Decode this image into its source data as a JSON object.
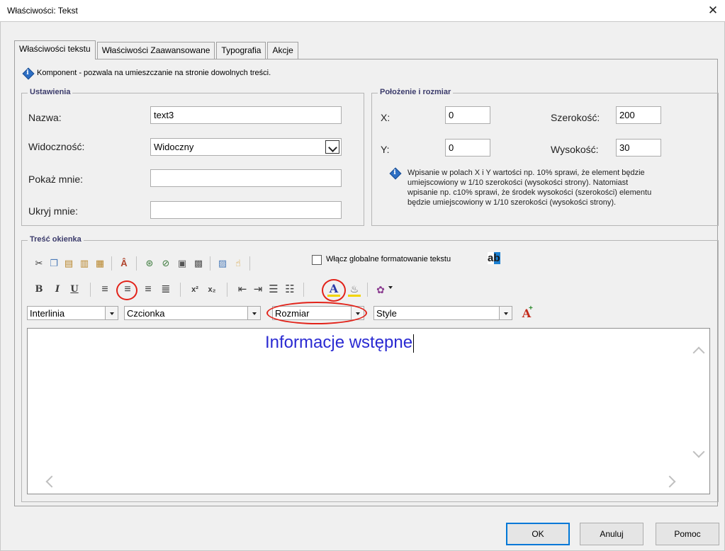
{
  "window": {
    "title": "Właściwości: Tekst",
    "close_glyph": "✕"
  },
  "tabs": [
    {
      "label": "Właściwości tekstu",
      "active": true
    },
    {
      "label": "Właściwości Zaawansowane",
      "active": false
    },
    {
      "label": "Typografia",
      "active": false
    },
    {
      "label": "Akcje",
      "active": false
    }
  ],
  "info": {
    "text": "Komponent - pozwala na umieszczanie na stronie dowolnych treści."
  },
  "settings": {
    "legend": "Ustawienia",
    "name_label": "Nazwa:",
    "name_value": "text3",
    "visibility_label": "Widoczność:",
    "visibility_value": "Widoczny",
    "show_label": "Pokaż mnie:",
    "show_value": "",
    "hide_label": "Ukryj mnie:",
    "hide_value": ""
  },
  "position": {
    "legend": "Położenie i rozmiar",
    "x_label": "X:",
    "x_value": "0",
    "y_label": "Y:",
    "y_value": "0",
    "width_label": "Szerokość:",
    "width_value": "200",
    "height_label": "Wysokość:",
    "height_value": "30",
    "note_lines": [
      "Wpisanie w polach X i Y wartości np. 10% sprawi, że element będzie",
      "umiejscowiony w 1/10 szerokości (wysokości strony). Natomiast",
      "wpisanie np. c10% sprawi, że środek wysokości (szerokości) elementu",
      "będzie umiejscowiony w 1/10 szerokości (wysokości strony)."
    ]
  },
  "content": {
    "legend": "Treść okienka",
    "global_format_label": "Włącz globalne formatowanie tekstu",
    "global_format_icon_text": "ab",
    "bold_glyph": "B",
    "italic_glyph": "I",
    "underline_glyph": "U",
    "sup_glyph": "x²",
    "sub_glyph": "x₂",
    "font_color_glyph": "A",
    "combo_line_spacing": "Interlinia",
    "combo_font": "Czcionka",
    "combo_size": "Rozmiar",
    "combo_style": "Style",
    "editor_text": "Informacje wstępne"
  },
  "buttons": {
    "ok": "OK",
    "cancel": "Anuluj",
    "help": "Pomoc"
  },
  "colors": {
    "accent": "#0078d7",
    "highlight_red": "#e2231a",
    "editor_text": "#2a2ad2"
  }
}
